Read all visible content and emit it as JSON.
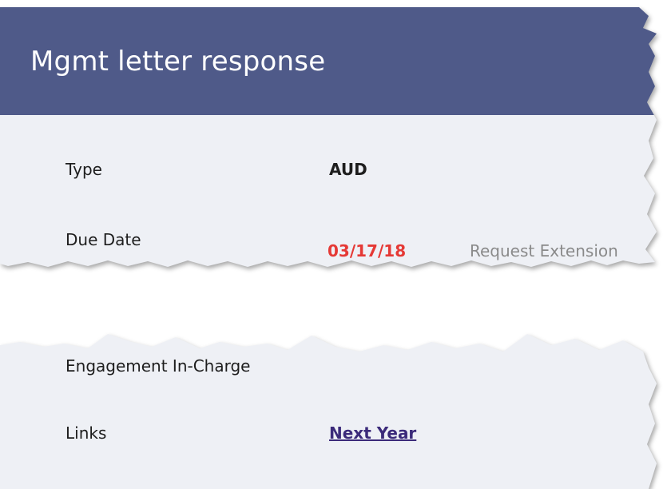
{
  "header": {
    "title": "Mgmt letter response"
  },
  "details": {
    "type_label": "Type",
    "type_value": "AUD",
    "due_date_label": "Due Date",
    "due_date_value": "03/17/18",
    "request_extension_label": "Request Extension",
    "engagement_in_charge_label": "Engagement In-Charge",
    "links_label": "Links",
    "next_year_link": "Next Year"
  },
  "colors": {
    "header_bg": "#4f5a89",
    "panel_bg": "#eef0f5",
    "due_date": "#e53935",
    "link": "#3b2a7a",
    "muted_link": "#8a8a8a"
  }
}
